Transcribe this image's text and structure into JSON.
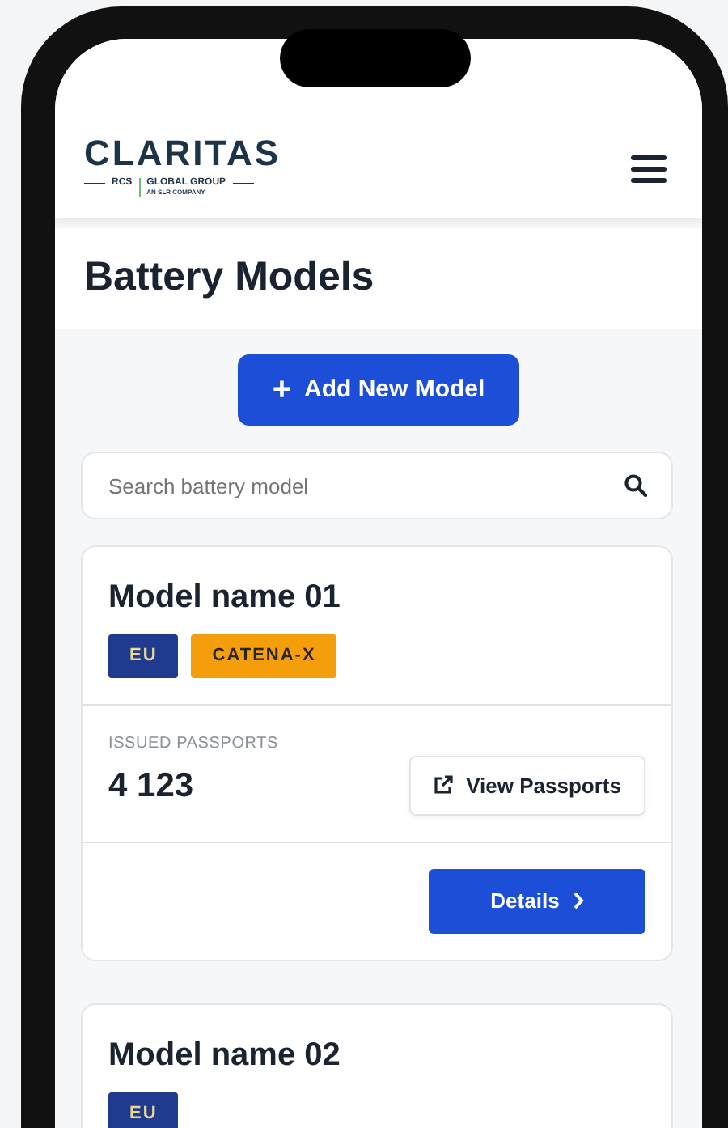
{
  "header": {
    "logo": {
      "name": "CLARITAS",
      "left": "RCS",
      "right": "GLOBAL GROUP",
      "sub": "AN SLR COMPANY"
    }
  },
  "page_title": "Battery Models",
  "add_button": {
    "label": "Add New Model",
    "icon": "+"
  },
  "search": {
    "placeholder": "Search battery model"
  },
  "models": [
    {
      "name": "Model name 01",
      "tags": [
        {
          "label": "EU",
          "color": "#1f3a8f"
        },
        {
          "label": "CATENA-X",
          "color": "#f59e0b"
        }
      ],
      "stat_label": "ISSUED PASSPORTS",
      "stat_value": "4 123",
      "view_button": "View Passports",
      "details_button": "Details"
    },
    {
      "name": "Model name 02",
      "tags": [
        {
          "label": "EU",
          "color": "#1f3a8f"
        }
      ]
    }
  ]
}
